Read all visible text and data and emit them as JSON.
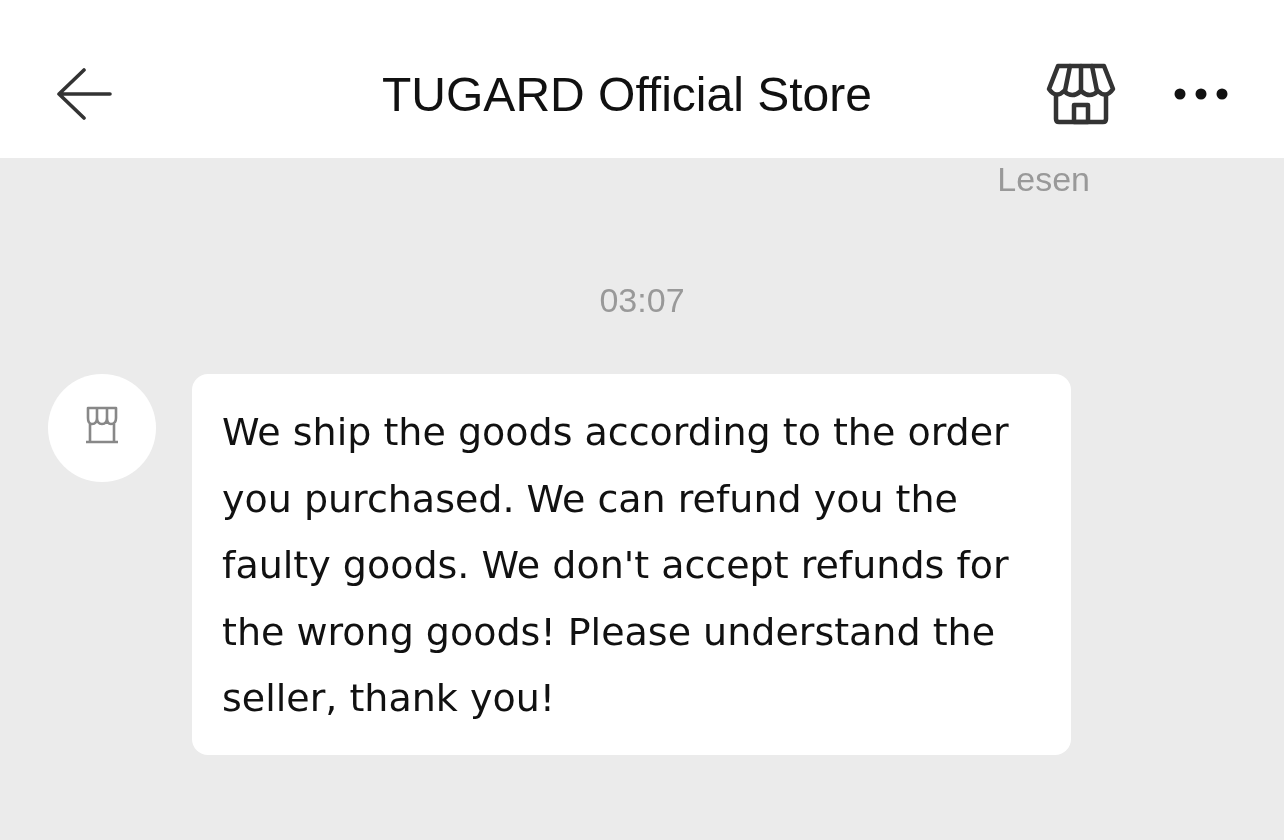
{
  "header": {
    "title": "TUGARD Official Store"
  },
  "read_status": "Lesen",
  "messages": [
    {
      "time": "03:07",
      "text": "We ship the goods according to the order you purchased. We can refund you the faulty goods. We don't accept refunds for the wrong goods! Please understand the seller, thank you!"
    }
  ]
}
